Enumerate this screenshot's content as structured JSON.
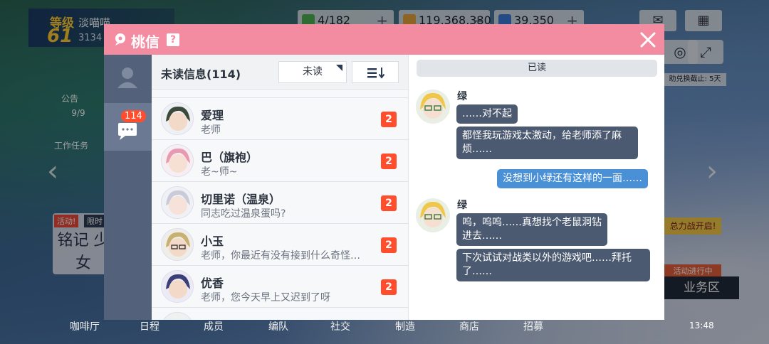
{
  "hud": {
    "level_label": "等级",
    "level_value": "61",
    "player_name": "淡喵喵",
    "player_sub": "3134",
    "resources": [
      {
        "value": "4/182",
        "color": "#4caf50"
      },
      {
        "value": "119,368,380",
        "color": "#e6a23c"
      },
      {
        "value": "39,350",
        "color": "#3a7bd5"
      }
    ],
    "exchange_note": "助兑换截止: 5天",
    "left_icons": [
      "公告",
      "9/9",
      "工作任务"
    ],
    "promo_left_tag": "活动!",
    "promo_left_sub": "限时",
    "promo_left_text": "铭记 少女",
    "promo_right_top": "总力战开启!",
    "promo_right_mid": "活动进行中",
    "biz_button": "业务区",
    "bottom_nav": [
      "咖啡厅",
      "日程",
      "成员",
      "编队",
      "社交",
      "制造",
      "商店",
      "招募"
    ],
    "clock": "13:48"
  },
  "dialog": {
    "title": "桃信",
    "help_label": "?",
    "side_badge": "114",
    "list": {
      "title": "未读信息(114)",
      "filter_label": "未读",
      "sort_icon": "sort-descending-icon",
      "rows": [
        {
          "name": "爱理",
          "preview": "老师",
          "badge": "2",
          "hue": "#3b4a3a"
        },
        {
          "name": "巴（旗袍）",
          "preview": "老~师~",
          "badge": "2",
          "hue": "#d86a8a"
        },
        {
          "name": "切里诺（温泉）",
          "preview": "同志吃过温泉蛋吗?",
          "badge": "2",
          "hue": "#c9ccd8"
        },
        {
          "name": "小玉",
          "preview": "老师，你最近有没有接到什么奇怪的...",
          "badge": "2",
          "hue": "#4a4236"
        },
        {
          "name": "优香",
          "preview": "老师，您今天早上又迟到了呀",
          "badge": "2",
          "hue": "#3a3f78"
        }
      ]
    },
    "chat": {
      "status": "已读",
      "messages": [
        {
          "sender": "绿",
          "bubbles": [
            "……对不起",
            "都怪我玩游戏太激动，给老师添了麻烦……"
          ]
        },
        {
          "me": "没想到小绿还有这样的一面……"
        },
        {
          "sender": "绿",
          "bubbles": [
            "呜，呜呜……真想找个老鼠洞钻进去……",
            "下次试试对战类以外的游戏吧……拜托了……"
          ]
        }
      ]
    }
  }
}
